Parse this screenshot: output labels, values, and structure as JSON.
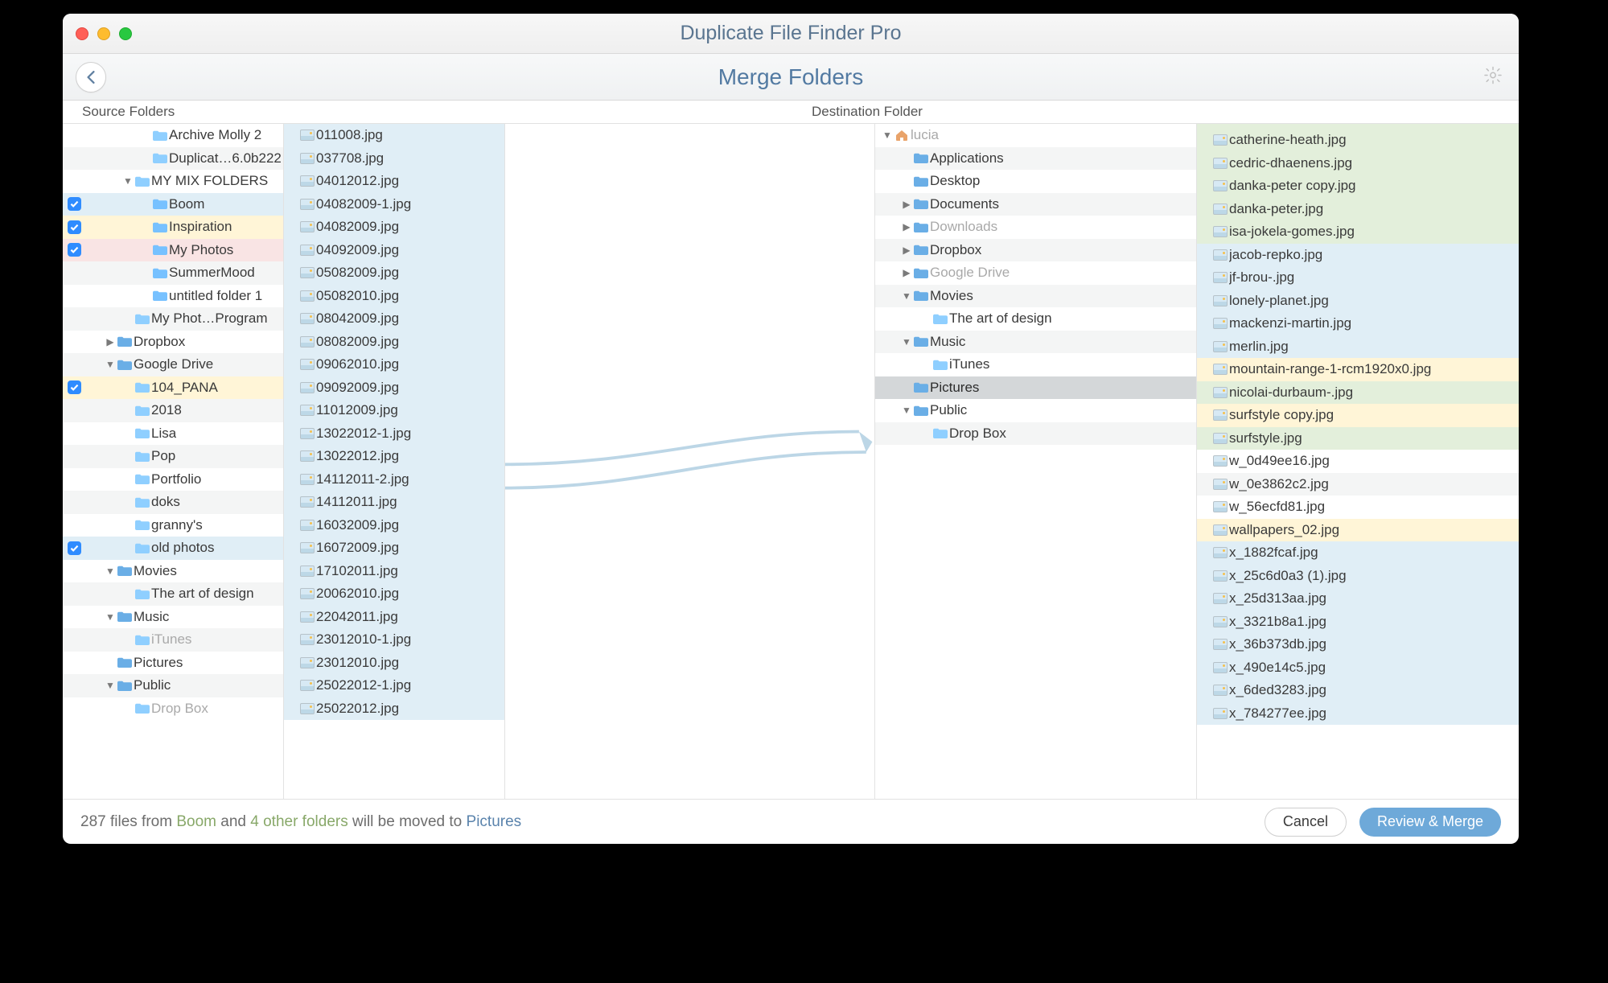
{
  "window": {
    "title": "Duplicate File Finder Pro",
    "subtitle": "Merge Folders"
  },
  "labels": {
    "source": "Source Folders",
    "destination": "Destination Folder"
  },
  "source_tree": [
    {
      "indent": 2,
      "checkbox": null,
      "disclosure": "",
      "icon": "folder",
      "label": "Archive Molly 2",
      "bg": "alt0"
    },
    {
      "indent": 2,
      "checkbox": null,
      "disclosure": "",
      "icon": "folder",
      "label": "Duplicat…6.0b222",
      "bg": "alt1"
    },
    {
      "indent": 1,
      "checkbox": null,
      "disclosure": "down",
      "icon": "folder",
      "label": "MY MIX FOLDERS",
      "bg": "alt0"
    },
    {
      "indent": 2,
      "checkbox": true,
      "disclosure": "",
      "icon": "folder-blue",
      "label": "Boom",
      "bg": "blue"
    },
    {
      "indent": 2,
      "checkbox": true,
      "disclosure": "",
      "icon": "folder-blue",
      "label": "Inspiration",
      "bg": "yellow"
    },
    {
      "indent": 2,
      "checkbox": true,
      "disclosure": "",
      "icon": "folder-blue",
      "label": "My Photos",
      "bg": "pink"
    },
    {
      "indent": 2,
      "checkbox": null,
      "disclosure": "",
      "icon": "folder-blue",
      "label": "SummerMood",
      "bg": "alt1"
    },
    {
      "indent": 2,
      "checkbox": null,
      "disclosure": "",
      "icon": "folder-blue",
      "label": "untitled folder 1",
      "bg": "alt0"
    },
    {
      "indent": 1,
      "checkbox": null,
      "disclosure": "",
      "icon": "folder",
      "label": "My Phot…Program",
      "bg": "alt1"
    },
    {
      "indent": 0,
      "checkbox": null,
      "disclosure": "right",
      "icon": "dropbox",
      "label": "Dropbox",
      "bg": "alt0"
    },
    {
      "indent": 0,
      "checkbox": null,
      "disclosure": "down",
      "icon": "gdrive",
      "label": "Google Drive",
      "bg": "alt1"
    },
    {
      "indent": 1,
      "checkbox": true,
      "disclosure": "",
      "icon": "folder",
      "label": "104_PANA",
      "bg": "yellow"
    },
    {
      "indent": 1,
      "checkbox": null,
      "disclosure": "",
      "icon": "folder",
      "label": "2018",
      "bg": "alt1"
    },
    {
      "indent": 1,
      "checkbox": null,
      "disclosure": "",
      "icon": "folder",
      "label": "Lisa",
      "bg": "alt0"
    },
    {
      "indent": 1,
      "checkbox": null,
      "disclosure": "",
      "icon": "folder",
      "label": "Pop",
      "bg": "alt1"
    },
    {
      "indent": 1,
      "checkbox": null,
      "disclosure": "",
      "icon": "folder",
      "label": "Portfolio",
      "bg": "alt0"
    },
    {
      "indent": 1,
      "checkbox": null,
      "disclosure": "",
      "icon": "folder",
      "label": "doks",
      "bg": "alt1"
    },
    {
      "indent": 1,
      "checkbox": null,
      "disclosure": "",
      "icon": "folder",
      "label": "granny's",
      "bg": "alt0"
    },
    {
      "indent": 1,
      "checkbox": true,
      "disclosure": "",
      "icon": "folder",
      "label": "old photos",
      "bg": "blue"
    },
    {
      "indent": 0,
      "checkbox": null,
      "disclosure": "down",
      "icon": "movies",
      "label": "Movies",
      "bg": "alt0"
    },
    {
      "indent": 1,
      "checkbox": null,
      "disclosure": "",
      "icon": "folder",
      "label": "The art of design",
      "bg": "alt1"
    },
    {
      "indent": 0,
      "checkbox": null,
      "disclosure": "down",
      "icon": "music",
      "label": "Music",
      "bg": "alt0"
    },
    {
      "indent": 1,
      "checkbox": null,
      "disclosure": "",
      "icon": "folder",
      "label": "iTunes",
      "bg": "alt1",
      "dim": true
    },
    {
      "indent": 0,
      "checkbox": null,
      "disclosure": "",
      "icon": "pictures",
      "label": "Pictures",
      "bg": "alt0"
    },
    {
      "indent": 0,
      "checkbox": null,
      "disclosure": "down",
      "icon": "public",
      "label": "Public",
      "bg": "alt1"
    },
    {
      "indent": 1,
      "checkbox": null,
      "disclosure": "",
      "icon": "folder",
      "label": "Drop Box",
      "bg": "alt0",
      "dim": true
    }
  ],
  "source_files": [
    {
      "n": "011008.jpg"
    },
    {
      "n": "037708.jpg"
    },
    {
      "n": "04012012.jpg"
    },
    {
      "n": "04082009-1.jpg"
    },
    {
      "n": "04082009.jpg"
    },
    {
      "n": "04092009.jpg"
    },
    {
      "n": "05082009.jpg"
    },
    {
      "n": "05082010.jpg"
    },
    {
      "n": "08042009.jpg"
    },
    {
      "n": "08082009.jpg"
    },
    {
      "n": "09062010.jpg"
    },
    {
      "n": "09092009.jpg"
    },
    {
      "n": "11012009.jpg"
    },
    {
      "n": "13022012-1.jpg"
    },
    {
      "n": "13022012.jpg"
    },
    {
      "n": "14112011-2.jpg"
    },
    {
      "n": "14112011.jpg"
    },
    {
      "n": "16032009.jpg"
    },
    {
      "n": "16072009.jpg"
    },
    {
      "n": "17102011.jpg"
    },
    {
      "n": "20062010.jpg"
    },
    {
      "n": "22042011.jpg"
    },
    {
      "n": "23012010-1.jpg"
    },
    {
      "n": "23012010.jpg"
    },
    {
      "n": "25022012-1.jpg"
    },
    {
      "n": "25022012.jpg"
    }
  ],
  "destination_tree": [
    {
      "indent": 0,
      "disclosure": "down",
      "icon": "home",
      "label": "lucia",
      "bg": "alt0",
      "dim": true
    },
    {
      "indent": 1,
      "disclosure": "",
      "icon": "apps",
      "label": "Applications",
      "bg": "alt1"
    },
    {
      "indent": 1,
      "disclosure": "",
      "icon": "desktop",
      "label": "Desktop",
      "bg": "alt0"
    },
    {
      "indent": 1,
      "disclosure": "right",
      "icon": "docs",
      "label": "Documents",
      "bg": "alt1"
    },
    {
      "indent": 1,
      "disclosure": "right",
      "icon": "downloads",
      "label": "Downloads",
      "bg": "alt0",
      "dim": true
    },
    {
      "indent": 1,
      "disclosure": "right",
      "icon": "dropbox",
      "label": "Dropbox",
      "bg": "alt1"
    },
    {
      "indent": 1,
      "disclosure": "right",
      "icon": "gdrive",
      "label": "Google Drive",
      "bg": "alt0",
      "dim": true
    },
    {
      "indent": 1,
      "disclosure": "down",
      "icon": "movies",
      "label": "Movies",
      "bg": "alt1"
    },
    {
      "indent": 2,
      "disclosure": "",
      "icon": "folder",
      "label": "The art of design",
      "bg": "alt0"
    },
    {
      "indent": 1,
      "disclosure": "down",
      "icon": "music",
      "label": "Music",
      "bg": "alt1"
    },
    {
      "indent": 2,
      "disclosure": "",
      "icon": "folder",
      "label": "iTunes",
      "bg": "alt0"
    },
    {
      "indent": 1,
      "disclosure": "",
      "icon": "pictures",
      "label": "Pictures",
      "bg": "sel"
    },
    {
      "indent": 1,
      "disclosure": "down",
      "icon": "public",
      "label": "Public",
      "bg": "alt0"
    },
    {
      "indent": 2,
      "disclosure": "",
      "icon": "folder",
      "label": "Drop Box",
      "bg": "alt1"
    }
  ],
  "destination_files": [
    {
      "n": "catherine-heath.jpg",
      "bg": "green"
    },
    {
      "n": "cedric-dhaenens.jpg",
      "bg": "green"
    },
    {
      "n": "danka-peter copy.jpg",
      "bg": "green"
    },
    {
      "n": "danka-peter.jpg",
      "bg": "green"
    },
    {
      "n": "isa-jokela-gomes.jpg",
      "bg": "green"
    },
    {
      "n": "jacob-repko.jpg",
      "bg": "blue"
    },
    {
      "n": "jf-brou-.jpg",
      "bg": "blue"
    },
    {
      "n": "lonely-planet.jpg",
      "bg": "blue"
    },
    {
      "n": "mackenzi-martin.jpg",
      "bg": "blue"
    },
    {
      "n": "merlin.jpg",
      "bg": "blue"
    },
    {
      "n": "mountain-range-1-rcm1920x0.jpg",
      "bg": "yellow"
    },
    {
      "n": "nicolai-durbaum-.jpg",
      "bg": "green"
    },
    {
      "n": "surfstyle copy.jpg",
      "bg": "yellow"
    },
    {
      "n": "surfstyle.jpg",
      "bg": "green"
    },
    {
      "n": "w_0d49ee16.jpg",
      "bg": "alt0"
    },
    {
      "n": "w_0e3862c2.jpg",
      "bg": "alt1"
    },
    {
      "n": "w_56ecfd81.jpg",
      "bg": "alt0"
    },
    {
      "n": "wallpapers_02.jpg",
      "bg": "yellow"
    },
    {
      "n": "x_1882fcaf.jpg",
      "bg": "blue"
    },
    {
      "n": "x_25c6d0a3 (1).jpg",
      "bg": "blue"
    },
    {
      "n": "x_25d313aa.jpg",
      "bg": "blue"
    },
    {
      "n": "x_3321b8a1.jpg",
      "bg": "blue"
    },
    {
      "n": "x_36b373db.jpg",
      "bg": "blue"
    },
    {
      "n": "x_490e14c5.jpg",
      "bg": "blue"
    },
    {
      "n": "x_6ded3283.jpg",
      "bg": "blue"
    },
    {
      "n": "x_784277ee.jpg",
      "bg": "blue"
    }
  ],
  "footer": {
    "count": "287",
    "from_word": "files from",
    "src_name": "Boom",
    "and": "and",
    "others": "4 other folders",
    "verb": "will be moved to",
    "dst_name": "Pictures",
    "cancel": "Cancel",
    "review": "Review & Merge"
  }
}
